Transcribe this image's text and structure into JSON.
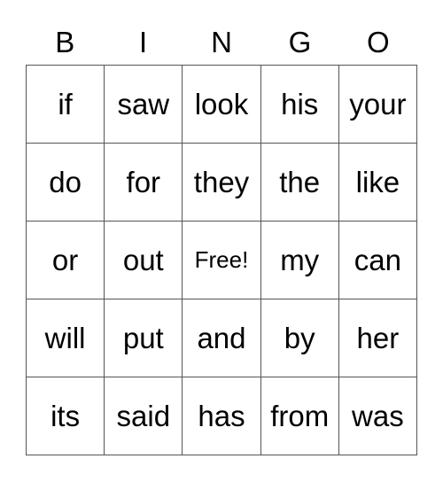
{
  "header": [
    "B",
    "I",
    "N",
    "G",
    "O"
  ],
  "cells": [
    [
      "if",
      "saw",
      "look",
      "his",
      "your"
    ],
    [
      "do",
      "for",
      "they",
      "the",
      "like"
    ],
    [
      "or",
      "out",
      "Free!",
      "my",
      "can"
    ],
    [
      "will",
      "put",
      "and",
      "by",
      "her"
    ],
    [
      "its",
      "said",
      "has",
      "from",
      "was"
    ]
  ]
}
